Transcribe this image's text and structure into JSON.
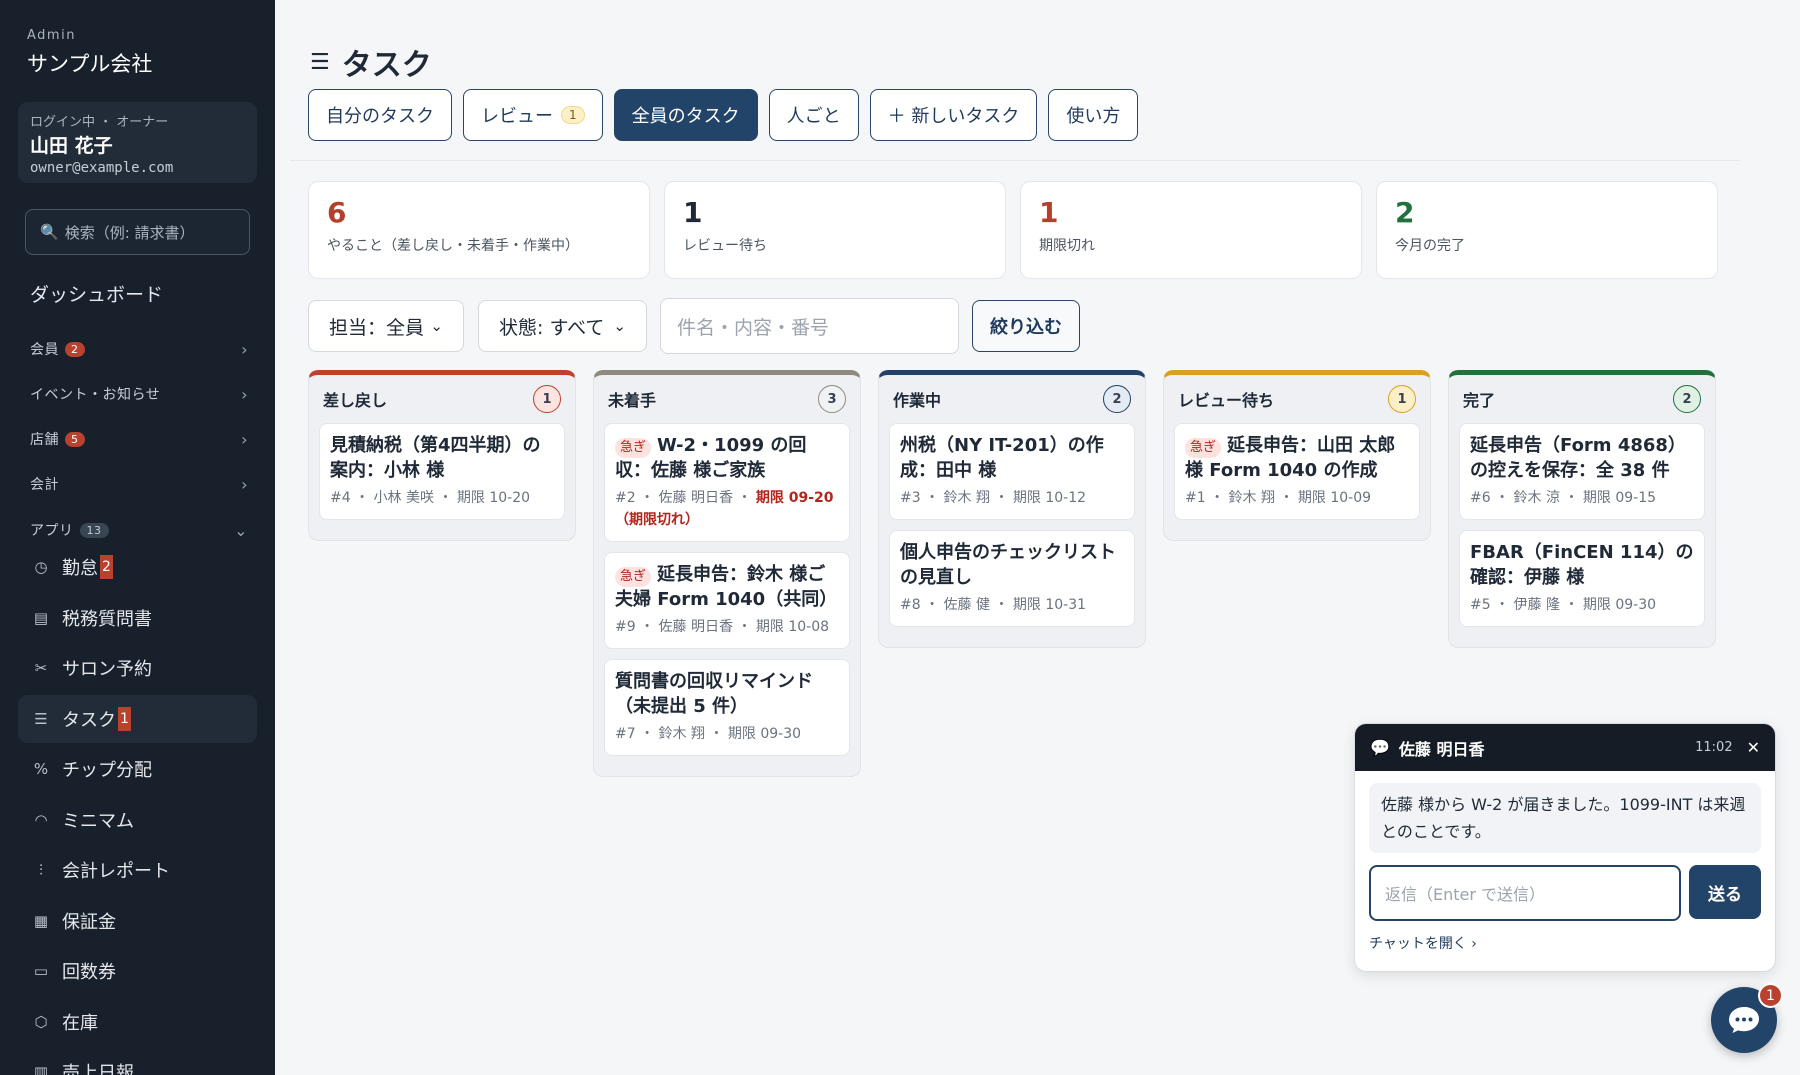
{
  "sidebar": {
    "eyebrow": "Admin",
    "company": "サンプル会社",
    "user": {
      "role": "ログイン中 ・ オーナー",
      "name": "山田 花子",
      "email": "owner@example.com"
    },
    "search_placeholder": "検索（例: 請求書）",
    "dashboard": "ダッシュボード",
    "groups": [
      {
        "label": "会員",
        "badge": "2",
        "expanded": false
      },
      {
        "label": "イベント・お知らせ",
        "badge": "",
        "expanded": false
      },
      {
        "label": "店舗",
        "badge": "5",
        "expanded": false
      },
      {
        "label": "会計",
        "badge": "",
        "expanded": false
      },
      {
        "label": "アプリ",
        "badge": "13",
        "expanded": true
      }
    ],
    "items": [
      {
        "label": "勤怠",
        "badge": "2",
        "icon": "clock-icon"
      },
      {
        "label": "税務質問書",
        "badge": "",
        "icon": "document-icon"
      },
      {
        "label": "サロン予約",
        "badge": "",
        "icon": "scissors-icon"
      },
      {
        "label": "タスク",
        "badge": "1",
        "icon": "checklist-icon",
        "active": true
      },
      {
        "label": "チップ分配",
        "badge": "",
        "icon": "percent-icon"
      },
      {
        "label": "ミニマム",
        "badge": "",
        "icon": "gauge-icon"
      },
      {
        "label": "会計レポート",
        "badge": "",
        "icon": "chart-icon"
      },
      {
        "label": "保証金",
        "badge": "",
        "icon": "receipt-icon"
      },
      {
        "label": "回数券",
        "badge": "",
        "icon": "ticket-icon"
      },
      {
        "label": "在庫",
        "badge": "",
        "icon": "box-icon"
      },
      {
        "label": "売上日報",
        "badge": "",
        "icon": "bar-chart-icon"
      }
    ]
  },
  "page": {
    "title": "タスク"
  },
  "tabs": [
    {
      "label": "自分のタスク",
      "badge": ""
    },
    {
      "label": "レビュー",
      "badge": "1"
    },
    {
      "label": "全員のタスク",
      "badge": "",
      "active": true
    },
    {
      "label": "人ごと",
      "badge": ""
    },
    {
      "label": "＋ 新しいタスク",
      "badge": ""
    },
    {
      "label": "使い方",
      "badge": ""
    }
  ],
  "stats": [
    {
      "value": "6",
      "label": "やること（差し戻し・未着手・作業中）",
      "color": "#b3402a"
    },
    {
      "value": "1",
      "label": "レビュー待ち",
      "color": "#1f2937"
    },
    {
      "value": "1",
      "label": "期限切れ",
      "color": "#b3402a"
    },
    {
      "value": "2",
      "label": "今月の完了",
      "color": "#22703a"
    }
  ],
  "filters": {
    "assignee": "担当：全員",
    "status": "状態: すべて",
    "search_placeholder": "件名・内容・番号",
    "submit": "絞り込む"
  },
  "columns": [
    {
      "title": "差し戻し",
      "count": "1",
      "color": "#c0402e",
      "count_bg": "#fde4e1",
      "cards": [
        {
          "title": "見積納税（第4四半期）の案内：小林 様",
          "urgent": false,
          "meta": "#4 ・ 小林 美咲 ・ 期限 10-20",
          "overdue": ""
        }
      ]
    },
    {
      "title": "未着手",
      "count": "3",
      "color": "#8e8b7e",
      "count_bg": "#f1f2f4",
      "cards": [
        {
          "title": "W-2・1099 の回収：佐藤 様ご家族",
          "urgent": true,
          "meta": "#2 ・ 佐藤 明日香 ・ ",
          "overdue": "期限 09-20（期限切れ）"
        },
        {
          "title": "延長申告：鈴木 様ご夫婦 Form 1040（共同）",
          "urgent": true,
          "meta": "#9 ・ 佐藤 明日香 ・ 期限 10-08",
          "overdue": ""
        },
        {
          "title": "質問書の回収リマインド（未提出 5 件）",
          "urgent": false,
          "meta": "#7 ・ 鈴木 翔 ・ 期限 09-30",
          "overdue": ""
        }
      ]
    },
    {
      "title": "作業中",
      "count": "2",
      "color": "#22416a",
      "count_bg": "#e3ebf5",
      "cards": [
        {
          "title": "州税（NY IT-201）の作成：田中 様",
          "urgent": false,
          "meta": "#3 ・ 鈴木 翔 ・ 期限 10-12",
          "overdue": ""
        },
        {
          "title": "個人申告のチェックリストの見直し",
          "urgent": false,
          "meta": "#8 ・ 佐藤 健 ・ 期限 10-31",
          "overdue": ""
        }
      ]
    },
    {
      "title": "レビュー待ち",
      "count": "1",
      "color": "#d9a022",
      "count_bg": "#fdf0c9",
      "cards": [
        {
          "title": "延長申告：山田 太郎 様 Form 1040 の作成",
          "urgent": true,
          "meta": "#1 ・ 鈴木 翔 ・ 期限 10-09",
          "overdue": ""
        }
      ]
    },
    {
      "title": "完了",
      "count": "2",
      "color": "#23703d",
      "count_bg": "#e0f1e4",
      "cards": [
        {
          "title": "延長申告（Form 4868）の控えを保存：全 38 件",
          "urgent": false,
          "meta": "#6 ・ 鈴木 涼 ・ 期限 09-15",
          "overdue": ""
        },
        {
          "title": "FBAR（FinCEN 114）の確認：伊藤 様",
          "urgent": false,
          "meta": "#5 ・ 伊藤 隆 ・ 期限 09-30",
          "overdue": ""
        }
      ]
    }
  ],
  "urgent_label": "急ぎ",
  "chat": {
    "name": "佐藤 明日香",
    "time": "11:02",
    "message": "佐藤 様から W-2 が届きました。1099-INT は来週とのことです。",
    "input_placeholder": "返信（Enter で送信）",
    "send": "送る",
    "open_link": "チャットを開く ›",
    "fab_badge": "1"
  }
}
